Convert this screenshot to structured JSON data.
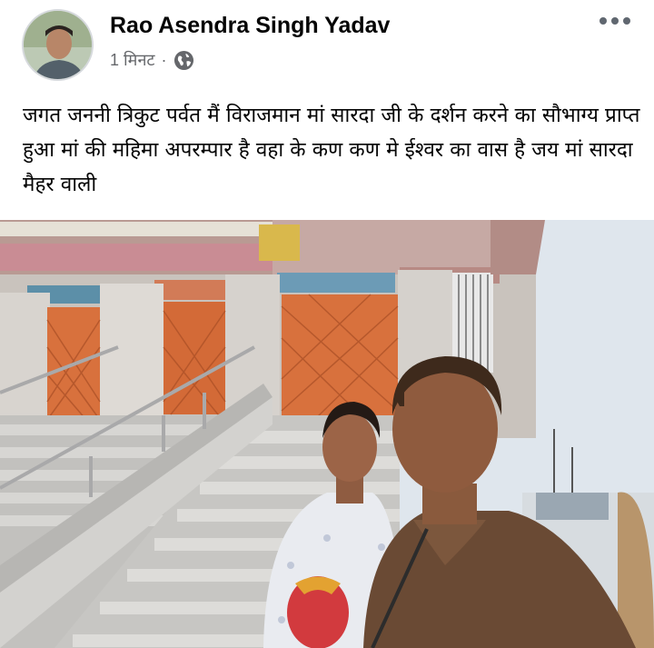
{
  "post": {
    "author": "Rao Asendra Singh Yadav",
    "time": "1 मिनट",
    "separator": "·",
    "privacy_icon": "globe-icon",
    "more_icon": "more-options-icon",
    "text": "जगत जननी त्रिकुट पर्वत मैं विराजमान मां सारदा जी के दर्शन करने का सौभाग्य प्राप्त हुआ मां की महिमा अपरम्पार है वहा के कण कण मे ईश्वर का वास है जय मां सारदा मैहर वाली"
  },
  "colors": {
    "name_text": "#050505",
    "meta_text": "#65676b",
    "icon_gray": "#606770",
    "gate_orange": "#d8713d",
    "sky": "#dfe6ed"
  }
}
